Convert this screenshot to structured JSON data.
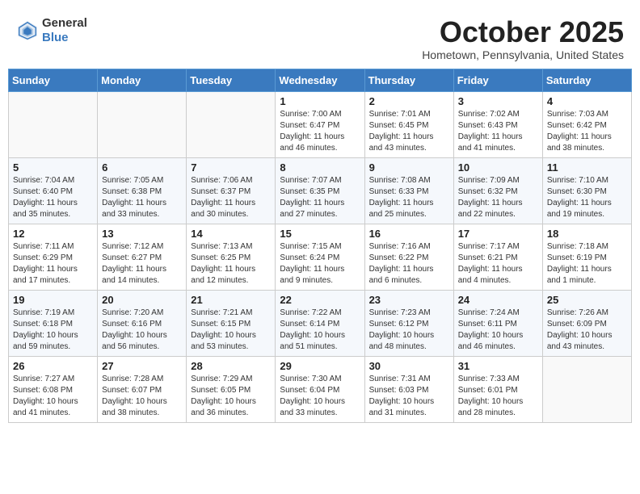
{
  "header": {
    "logo_general": "General",
    "logo_blue": "Blue",
    "month_title": "October 2025",
    "subtitle": "Hometown, Pennsylvania, United States"
  },
  "weekdays": [
    "Sunday",
    "Monday",
    "Tuesday",
    "Wednesday",
    "Thursday",
    "Friday",
    "Saturday"
  ],
  "weeks": [
    [
      {
        "day": "",
        "info": ""
      },
      {
        "day": "",
        "info": ""
      },
      {
        "day": "",
        "info": ""
      },
      {
        "day": "1",
        "info": "Sunrise: 7:00 AM\nSunset: 6:47 PM\nDaylight: 11 hours\nand 46 minutes."
      },
      {
        "day": "2",
        "info": "Sunrise: 7:01 AM\nSunset: 6:45 PM\nDaylight: 11 hours\nand 43 minutes."
      },
      {
        "day": "3",
        "info": "Sunrise: 7:02 AM\nSunset: 6:43 PM\nDaylight: 11 hours\nand 41 minutes."
      },
      {
        "day": "4",
        "info": "Sunrise: 7:03 AM\nSunset: 6:42 PM\nDaylight: 11 hours\nand 38 minutes."
      }
    ],
    [
      {
        "day": "5",
        "info": "Sunrise: 7:04 AM\nSunset: 6:40 PM\nDaylight: 11 hours\nand 35 minutes."
      },
      {
        "day": "6",
        "info": "Sunrise: 7:05 AM\nSunset: 6:38 PM\nDaylight: 11 hours\nand 33 minutes."
      },
      {
        "day": "7",
        "info": "Sunrise: 7:06 AM\nSunset: 6:37 PM\nDaylight: 11 hours\nand 30 minutes."
      },
      {
        "day": "8",
        "info": "Sunrise: 7:07 AM\nSunset: 6:35 PM\nDaylight: 11 hours\nand 27 minutes."
      },
      {
        "day": "9",
        "info": "Sunrise: 7:08 AM\nSunset: 6:33 PM\nDaylight: 11 hours\nand 25 minutes."
      },
      {
        "day": "10",
        "info": "Sunrise: 7:09 AM\nSunset: 6:32 PM\nDaylight: 11 hours\nand 22 minutes."
      },
      {
        "day": "11",
        "info": "Sunrise: 7:10 AM\nSunset: 6:30 PM\nDaylight: 11 hours\nand 19 minutes."
      }
    ],
    [
      {
        "day": "12",
        "info": "Sunrise: 7:11 AM\nSunset: 6:29 PM\nDaylight: 11 hours\nand 17 minutes."
      },
      {
        "day": "13",
        "info": "Sunrise: 7:12 AM\nSunset: 6:27 PM\nDaylight: 11 hours\nand 14 minutes."
      },
      {
        "day": "14",
        "info": "Sunrise: 7:13 AM\nSunset: 6:25 PM\nDaylight: 11 hours\nand 12 minutes."
      },
      {
        "day": "15",
        "info": "Sunrise: 7:15 AM\nSunset: 6:24 PM\nDaylight: 11 hours\nand 9 minutes."
      },
      {
        "day": "16",
        "info": "Sunrise: 7:16 AM\nSunset: 6:22 PM\nDaylight: 11 hours\nand 6 minutes."
      },
      {
        "day": "17",
        "info": "Sunrise: 7:17 AM\nSunset: 6:21 PM\nDaylight: 11 hours\nand 4 minutes."
      },
      {
        "day": "18",
        "info": "Sunrise: 7:18 AM\nSunset: 6:19 PM\nDaylight: 11 hours\nand 1 minute."
      }
    ],
    [
      {
        "day": "19",
        "info": "Sunrise: 7:19 AM\nSunset: 6:18 PM\nDaylight: 10 hours\nand 59 minutes."
      },
      {
        "day": "20",
        "info": "Sunrise: 7:20 AM\nSunset: 6:16 PM\nDaylight: 10 hours\nand 56 minutes."
      },
      {
        "day": "21",
        "info": "Sunrise: 7:21 AM\nSunset: 6:15 PM\nDaylight: 10 hours\nand 53 minutes."
      },
      {
        "day": "22",
        "info": "Sunrise: 7:22 AM\nSunset: 6:14 PM\nDaylight: 10 hours\nand 51 minutes."
      },
      {
        "day": "23",
        "info": "Sunrise: 7:23 AM\nSunset: 6:12 PM\nDaylight: 10 hours\nand 48 minutes."
      },
      {
        "day": "24",
        "info": "Sunrise: 7:24 AM\nSunset: 6:11 PM\nDaylight: 10 hours\nand 46 minutes."
      },
      {
        "day": "25",
        "info": "Sunrise: 7:26 AM\nSunset: 6:09 PM\nDaylight: 10 hours\nand 43 minutes."
      }
    ],
    [
      {
        "day": "26",
        "info": "Sunrise: 7:27 AM\nSunset: 6:08 PM\nDaylight: 10 hours\nand 41 minutes."
      },
      {
        "day": "27",
        "info": "Sunrise: 7:28 AM\nSunset: 6:07 PM\nDaylight: 10 hours\nand 38 minutes."
      },
      {
        "day": "28",
        "info": "Sunrise: 7:29 AM\nSunset: 6:05 PM\nDaylight: 10 hours\nand 36 minutes."
      },
      {
        "day": "29",
        "info": "Sunrise: 7:30 AM\nSunset: 6:04 PM\nDaylight: 10 hours\nand 33 minutes."
      },
      {
        "day": "30",
        "info": "Sunrise: 7:31 AM\nSunset: 6:03 PM\nDaylight: 10 hours\nand 31 minutes."
      },
      {
        "day": "31",
        "info": "Sunrise: 7:33 AM\nSunset: 6:01 PM\nDaylight: 10 hours\nand 28 minutes."
      },
      {
        "day": "",
        "info": ""
      }
    ]
  ]
}
